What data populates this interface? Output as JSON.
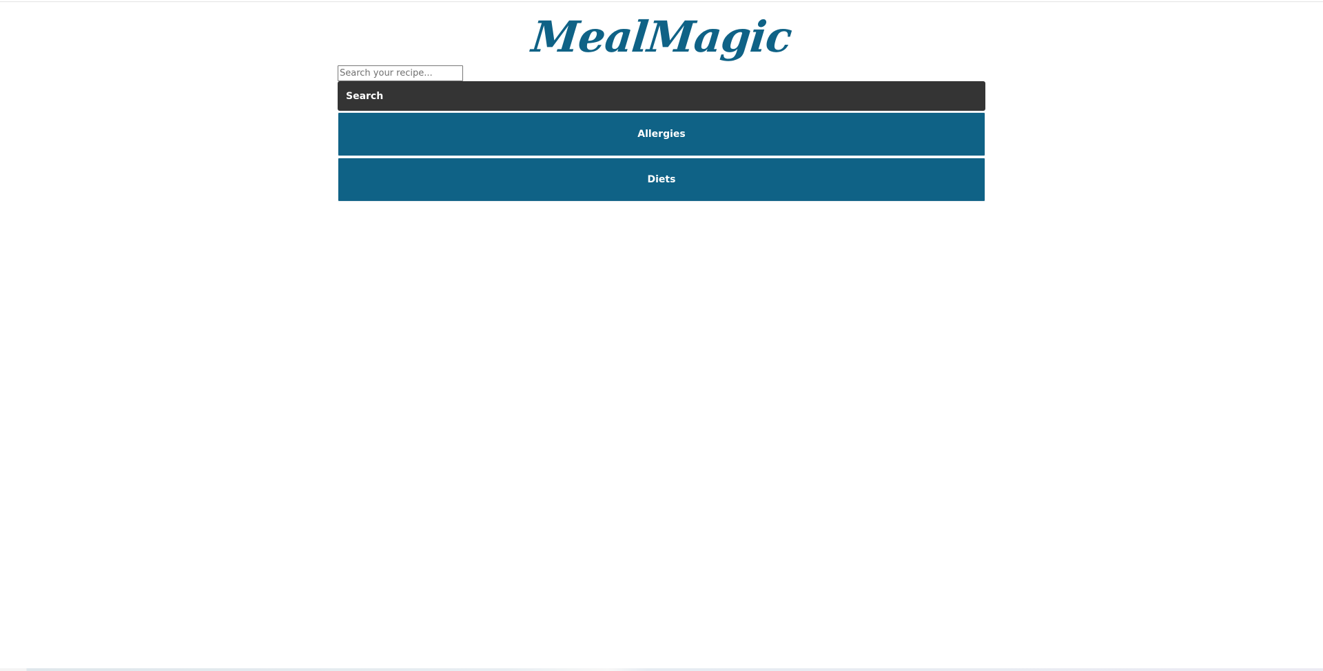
{
  "header": {
    "logo_text": "MealMagic"
  },
  "search": {
    "placeholder": "Search your recipe...",
    "value": "",
    "button_label": "Search"
  },
  "filters": [
    {
      "label": "Allergies"
    },
    {
      "label": "Diets"
    }
  ],
  "colors": {
    "brand": "#0f6286",
    "search_button_bg": "#343434",
    "button_text": "#ffffff"
  }
}
